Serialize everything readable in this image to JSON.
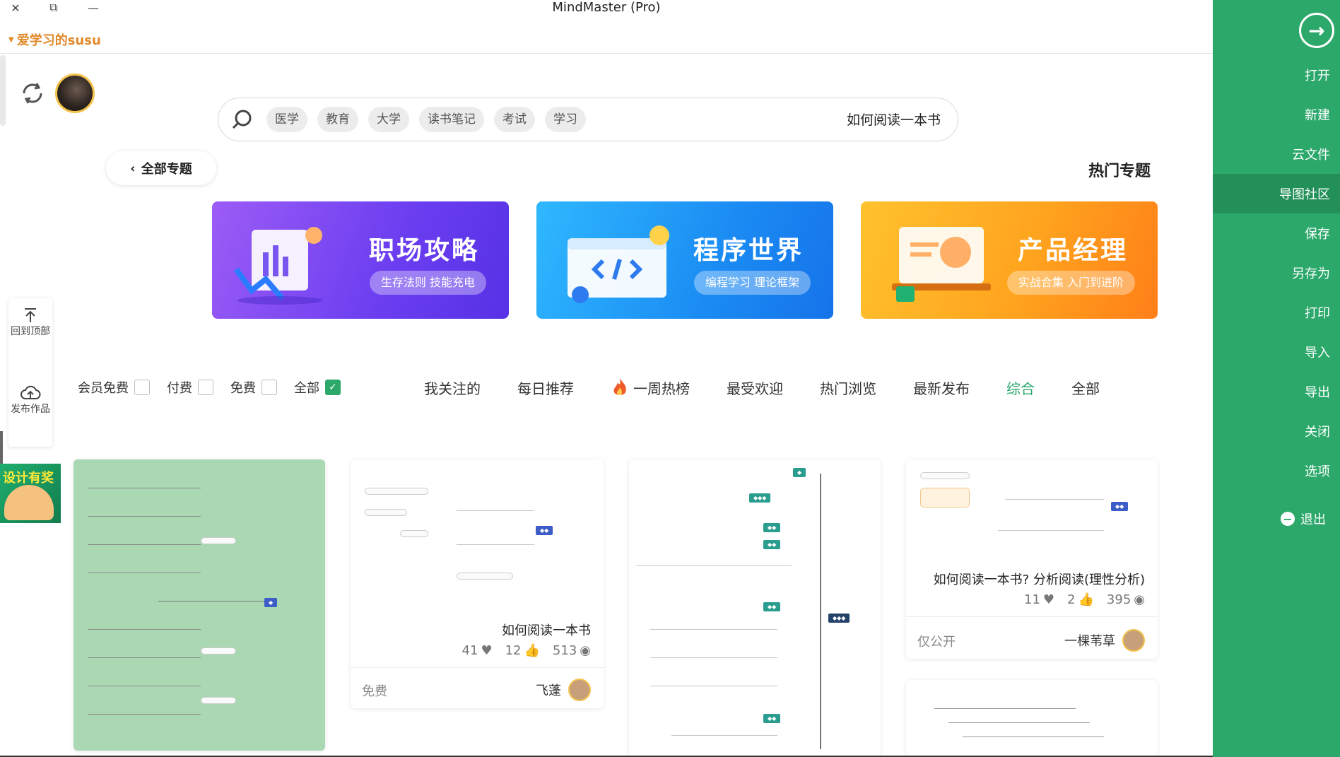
{
  "window": {
    "title": "MindMaster (Pro)"
  },
  "user": {
    "name": "爱学习的susu"
  },
  "sidebar": {
    "items": [
      {
        "label": "打开"
      },
      {
        "label": "新建"
      },
      {
        "label": "云文件"
      },
      {
        "label": "导图社区"
      },
      {
        "label": "保存"
      },
      {
        "label": "另存为"
      },
      {
        "label": "打印"
      },
      {
        "label": "导入"
      },
      {
        "label": "导出"
      },
      {
        "label": "关闭"
      },
      {
        "label": "选项"
      },
      {
        "label": "退出"
      }
    ],
    "active_index": 3,
    "accent": "#2ba86a"
  },
  "search": {
    "query": "如何阅读一本书",
    "tags": [
      "医学",
      "教育",
      "大学",
      "读书笔记",
      "考试",
      "学习"
    ]
  },
  "topics": {
    "back_label": "全部专题",
    "hot_title": "热门专题",
    "banners": [
      {
        "title": "职场攻略",
        "pill": "生存法则 技能充电"
      },
      {
        "title": "程序世界",
        "pill": "编程学习 理论框架"
      },
      {
        "title": "产品经理",
        "pill": "实战合集 入门到进阶"
      }
    ]
  },
  "floatbar": {
    "top_label": "回到顶部",
    "publish_label": "发布作品"
  },
  "ad": {
    "text": "设计有奖"
  },
  "filters": {
    "nav": [
      "全部",
      "综合",
      "最新发布",
      "热门浏览",
      "最受欢迎",
      "一周热榜",
      "每日推荐",
      "我关注的"
    ],
    "active_nav": "综合",
    "checks": [
      {
        "label": "全部",
        "checked": true
      },
      {
        "label": "免费",
        "checked": false
      },
      {
        "label": "付费",
        "checked": false
      },
      {
        "label": "会员免费",
        "checked": false
      }
    ]
  },
  "cards": [
    {
      "title": "如何阅读一本书? 分析阅读(理性分析)",
      "views": "395",
      "likes": "2",
      "favs": "11",
      "author": "一棵苇草",
      "price": "仅公开"
    },
    {
      "title": "如何阅读一本书",
      "views": "513",
      "likes": "12",
      "favs": "41",
      "author": "飞蓬",
      "price": "免费"
    }
  ]
}
